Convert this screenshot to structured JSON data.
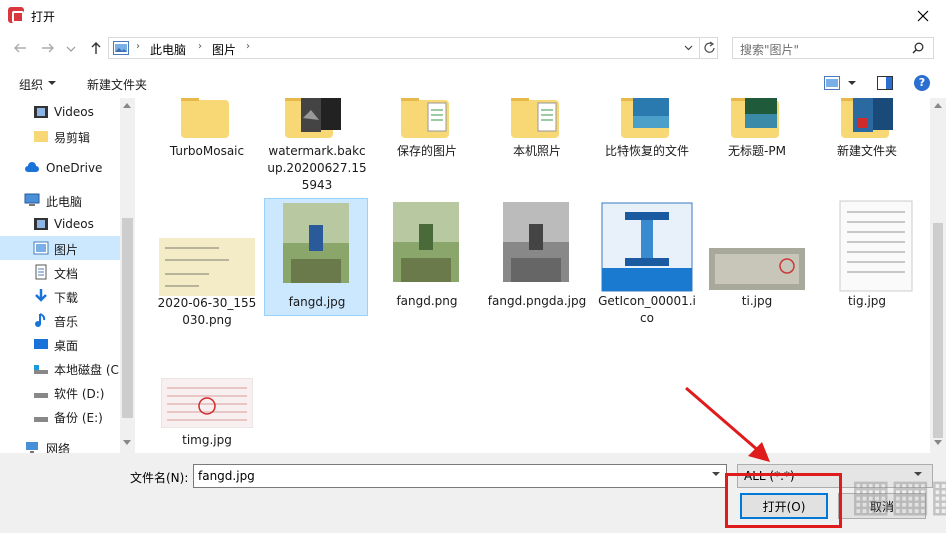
{
  "window": {
    "title": "打开"
  },
  "address": {
    "crumbs": [
      "此电脑",
      "图片"
    ]
  },
  "search": {
    "placeholder": "搜索\"图片\""
  },
  "toolbar": {
    "organize": "组织",
    "new_folder": "新建文件夹"
  },
  "nav": {
    "items": [
      {
        "label": "Videos",
        "icon": "video-icon"
      },
      {
        "label": "易剪辑",
        "icon": "folder-icon"
      },
      {
        "label": "OneDrive",
        "icon": "cloud-icon"
      },
      {
        "label": "此电脑",
        "icon": "computer-icon"
      },
      {
        "label": "Videos",
        "icon": "video-icon"
      },
      {
        "label": "图片",
        "icon": "pictures-icon",
        "selected": true
      },
      {
        "label": "文档",
        "icon": "document-icon"
      },
      {
        "label": "下载",
        "icon": "download-icon"
      },
      {
        "label": "音乐",
        "icon": "music-icon"
      },
      {
        "label": "桌面",
        "icon": "desktop-icon"
      },
      {
        "label": "本地磁盘 (C",
        "icon": "drive-icon"
      },
      {
        "label": "软件 (D:)",
        "icon": "drive-icon"
      },
      {
        "label": "备份 (E:)",
        "icon": "drive-icon"
      },
      {
        "label": "网络",
        "icon": "network-icon"
      }
    ]
  },
  "files": {
    "row1": [
      "TurboMosaic",
      "watermark.bakcup.20200627.155943",
      "保存的图片",
      "本机照片",
      "比特恢复的文件",
      "无标题-PM",
      "新建文件夹"
    ],
    "row2": [
      "2020-06-30_155030.png",
      "fangd.jpg",
      "fangd.png",
      "fangd.pngda.jpg",
      "GetIcon_00001.ico",
      "ti.jpg",
      "tig.jpg"
    ],
    "row3": [
      "timg.jpg"
    ]
  },
  "bottom": {
    "filename_label": "文件名(N):",
    "filename_value": "fangd.jpg",
    "filter_value": "ALL (*.*)",
    "open_label": "打开(O)",
    "cancel_label": "取消"
  },
  "colors": {
    "selection": "#cce8ff",
    "accent": "#0078d7",
    "annotation": "#e01b1b"
  }
}
